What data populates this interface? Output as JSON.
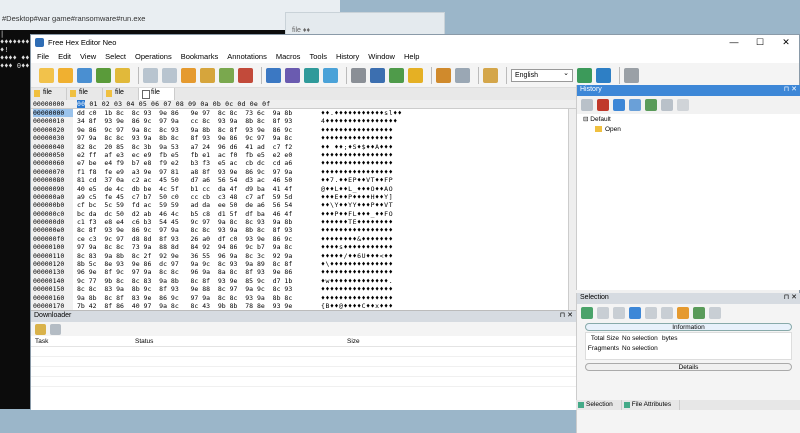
{
  "console": {
    "title": "#Desktop#war game#ransomware#run.exe",
    "lines": [
      "|",
      "♦♦♦♦♦♦♦♦",
      "",
      "",
      "",
      "♦!",
      "♦♦♦♦ ♦♦♦♦",
      "♦♦♦ 0♦♦♦ "
    ]
  },
  "bg_window_title": "file ♦♦",
  "app": {
    "title": "Free Hex Editor Neo",
    "window_controls": [
      "—",
      "☐",
      "✕"
    ],
    "menu": [
      "File",
      "Edit",
      "View",
      "Select",
      "Operations",
      "Bookmarks",
      "Annotations",
      "Macros",
      "Tools",
      "History",
      "Window",
      "Help"
    ],
    "language": "English"
  },
  "tabs": [
    "file",
    "file",
    "file",
    "file"
  ],
  "hex": {
    "offset_header": "00000000",
    "column_header_selected": "00",
    "column_header_rest": " 01  02  03   04  05  06  07   08  09  0a  0b   0c  0d  0e  0f",
    "offsets": [
      "00000000",
      "00000010",
      "00000020",
      "00000030",
      "00000040",
      "00000050",
      "00000060",
      "00000070",
      "00000080",
      "00000090",
      "000000a0",
      "000000b0",
      "000000c0",
      "000000d0",
      "000000e0",
      "000000f0",
      "00000100",
      "00000110",
      "00000120",
      "00000130",
      "00000140",
      "00000150",
      "00000160",
      "00000170"
    ],
    "rows": [
      "dd c0  1b 8c  8c 93  9e 86   9e 97  8c 8c  73 6c  9a 8b",
      "34 8f  93 9e  86 9c  97 9a   cc 8c  93 9a  8b 8c  8f 93",
      "9e 86  9c 97  9a 8c  8c 93   9a 8b  8c 8f  93 9e  86 9c",
      "97 9a  8c 8c  93 9a  8b 8c   8f 93  9e 86  9c 97  9a 8c",
      "82 8c  20 85  8c 3b  9a 53   a7 24  96 d6  41 ad  c7 f2",
      "e2 ff  af e3  ec e9  fb e5   fb e1  ac f0  fb e5  e2 e0",
      "e7 be  e4 f9  b7 e8  f9 e2   b3 f3  e5 ac  cb dc  cd a6",
      "f1 f8  fe e9  a3 9e  97 81   a8 8f  93 9e  86 9c  97 9a",
      "81 cd  37 0a  c2 ac  45 50   d7 a6  56 54  d3 ac  46 50",
      "40 e5  de 4c  db be  4c 5f   b1 cc  da 4f  d9 ba  41 4f",
      "a9 c5  fe 45  c7 b7  50 c0   cc cb  c3 48  c7 af  59 5d",
      "cf bc  5c 59  fd ac  59 59   ad da  ee 50  de a6  56 54",
      "bc da  dc 50  d2 ab  46 4c   b5 c8  d1 5f  df ba  46 4f",
      "c1 f3  e8 e4  c6 b3  54 45   9c 97  9a 8c  8c 93  9a 8b",
      "8c 8f  93 9e  86 9c  97 9a   8c 8c  93 9a  8b 8c  8f 93",
      "ce c3  9c 97  d8 8d  8f 93   26 a0  df c0  93 9e  86 9c",
      "97 9a  8c 8c  73 9a  88 8d   84 92  94 86  9c b7  9a 8c",
      "8c 83  9a 8b  8c 2f  92 9e   36 55  96 9a  8c 3c  92 9a",
      "8b 5c  8e 93  9e 86  dc 97   9a 9c  8c 93  9a 89  8c 8f",
      "96 9e  8f 9c  97 9a  8c 8c   96 9a  8a 8c  8f 93  9e 86",
      "9c 77  9b 8c  8c 83  9a 8b   8c 8f  93 9e  85 9c  d7 1b",
      "8c 8c  83 9a  8b 9c  8f 93   9e 88  8c 97  9a 9c  8c 93",
      "9a 8b  8c 8f  83 9e  86 9c   97 9a  8c 8c  93 9a  8b 8c",
      "7b 42  8f 86  40 97  9a 8c   8c 43  9b 8b  78 8e  93 9e"
    ],
    "ascii": [
      "♦♦.♦♦♦♦♦♦♦♦♦♦♦sl♦♦",
      "4♦♦♦♦♦♦♦♦♦♦♦♦♦♦♦♦",
      "♦♦♦♦♦♦♦♦♦♦♦♦♦♦♦♦",
      "♦♦♦♦♦♦♦♦♦♦♦♦♦♦♦♦",
      "♦♦ ♦♦;♦S♦$♦♦A♦♦♦",
      "♦♦♦♦♦♦♦♦♦♦♦♦♦♦♦♦",
      "♦♦♦♦♦♦♦♦♦♦♦♦♦♦♦♦",
      "♦♦♦♦♦♦♦♦♦♦♦♦♦♦♦♦",
      "♦♦7.♦♦EP♦♦VT♦♦FP",
      "@♦♦L♦♦L_♦♦♦O♦♦AO",
      "♦♦♦E♦♦P♦♦♦♦H♦♦Y]",
      "♦♦\\Y♦♦YY♦♦♦P♦♦VT",
      "♦♦♦P♦♦FL♦♦♦_♦♦FO",
      "♦♦♦♦♦♦TE♦♦♦♦♦♦♦♦",
      "♦♦♦♦♦♦♦♦♦♦♦♦♦♦♦♦",
      "♦♦♦♦♦♦♦♦&♦♦♦♦♦♦♦",
      "♦♦♦♦s♦♦♦♦♦♦♦♦♦♦♦",
      "♦♦♦♦♦/♦♦6U♦♦♦<♦♦",
      "♦\\♦♦♦♦♦♦♦♦♦♦♦♦♦♦",
      "♦♦♦♦♦♦♦♦♦♦♦♦♦♦♦♦",
      "♦w♦♦♦♦♦♦♦♦♦♦♦♦♦.",
      "♦♦♦♦♦♦♦♦♦♦♦♦♦♦♦♦",
      "♦♦♦♦♦♦♦♦♦♦♦♦♦♦♦♦",
      "{B♦♦@♦♦♦♦C♦♦x♦♦♦"
    ]
  },
  "history": {
    "title": "History",
    "controls": "⊓ ✕",
    "root": "Default",
    "child": "Open"
  },
  "selection": {
    "title": "Selection",
    "controls": "⊓ ✕",
    "info_header": "Information",
    "total_size_label": "Total Size",
    "total_size_value": "No selection",
    "total_size_unit": "bytes",
    "fragments_label": "Fragments",
    "fragments_value": "No selection",
    "details_header": "Details"
  },
  "bottom_tabs": [
    "Selection",
    "File Attributes"
  ],
  "downloader": {
    "title": "Downloader",
    "controls": "⊓ ✕",
    "columns": [
      "Task",
      "Status",
      "Size"
    ]
  },
  "colors": {
    "accent_blue": "#3d87d7",
    "selection_blue": "#2b79d0"
  }
}
